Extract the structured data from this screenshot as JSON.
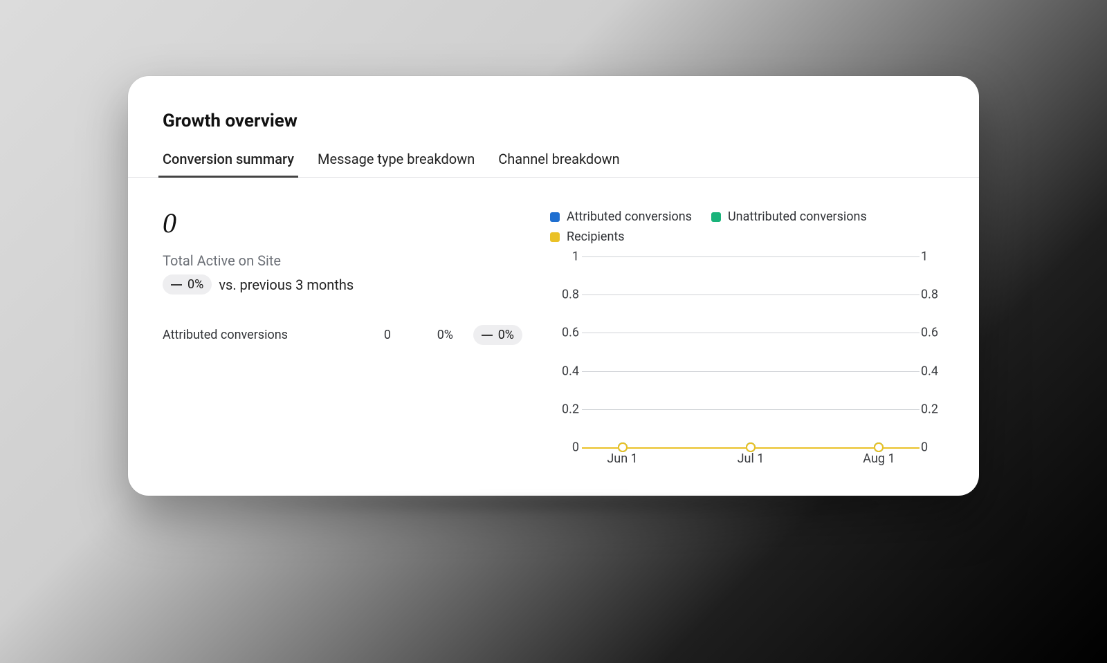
{
  "title": "Growth overview",
  "tabs": [
    {
      "label": "Conversion summary",
      "active": true
    },
    {
      "label": "Message type breakdown",
      "active": false
    },
    {
      "label": "Channel breakdown",
      "active": false
    }
  ],
  "summary": {
    "big_value": "0",
    "metric_label": "Total Active on Site",
    "delta_pct": "0%",
    "compare_label": "vs. previous 3 months"
  },
  "rows": [
    {
      "label": "Attributed conversions",
      "value": "0",
      "pct": "0%",
      "delta": "0%"
    }
  ],
  "legend": [
    {
      "name": "Attributed conversions",
      "color": "#1f6fd0"
    },
    {
      "name": "Unattributed conversions",
      "color": "#19b37a"
    },
    {
      "name": "Recipients",
      "color": "#eac127"
    }
  ],
  "chart_data": {
    "type": "line",
    "x": [
      "Jun 1",
      "Jul 1",
      "Aug 1"
    ],
    "ylim_left": [
      0,
      1
    ],
    "ylim_right": [
      0,
      1
    ],
    "yticks": [
      0,
      0.2,
      0.4,
      0.6,
      0.8,
      1
    ],
    "series": [
      {
        "name": "Attributed conversions",
        "color": "#1f6fd0",
        "values": [
          0,
          0,
          0
        ]
      },
      {
        "name": "Unattributed conversions",
        "color": "#19b37a",
        "values": [
          0,
          0,
          0
        ]
      },
      {
        "name": "Recipients",
        "color": "#eac127",
        "values": [
          0,
          0,
          0
        ]
      }
    ]
  }
}
